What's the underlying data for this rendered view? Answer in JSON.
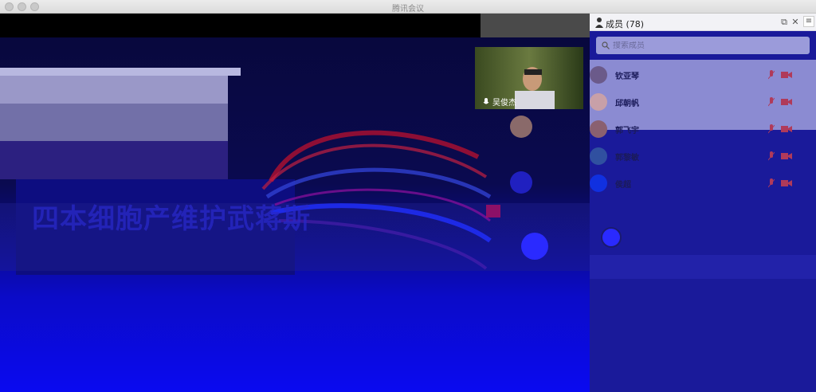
{
  "window": {
    "title": "腾讯会议"
  },
  "share": {
    "slide_title": "四本细胞产维护武蒋斯"
  },
  "video_tiles": [
    {
      "name": "吴俊杰"
    }
  ],
  "panel": {
    "title": "成员 (78)",
    "search_placeholder": "搜索成员",
    "members": [
      {
        "name": "钦亚琴",
        "avatar_color": "#6b5a8a"
      },
      {
        "name": "邱朝帆",
        "avatar_color": "#c8a0a8"
      },
      {
        "name": "郭飞宇",
        "avatar_color": "#8a6070"
      },
      {
        "name": "郭黎敏",
        "avatar_color": "#3050a0"
      },
      {
        "name": "侯超",
        "avatar_color": "#1030e0"
      }
    ]
  },
  "colors": {
    "accent": "#2a2aff",
    "panel_bg": "#1a1a9a",
    "icon_red": "#b03a5a"
  }
}
